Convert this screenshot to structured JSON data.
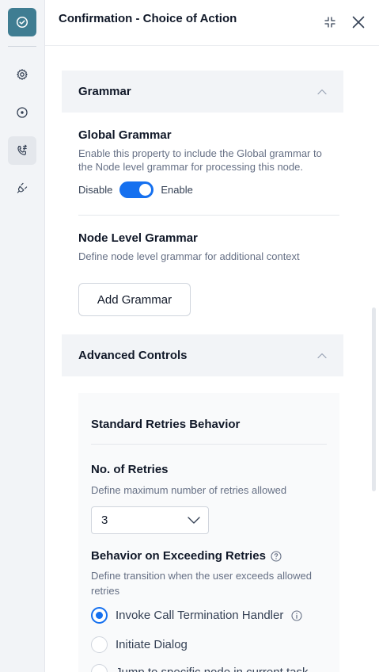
{
  "header": {
    "title": "Confirmation - Choice of Action"
  },
  "rail": {
    "items": [
      "check-circle-icon",
      "gear-icon",
      "target-icon",
      "phone-transfer-icon",
      "plug-icon"
    ],
    "active": "phone-transfer-icon"
  },
  "grammar": {
    "section_title": "Grammar",
    "global_title": "Global Grammar",
    "global_desc_line1": "Enable this property to include the Global grammar to",
    "global_desc_line2": "the Node level grammar for processing this node.",
    "toggle_off_label": "Disable",
    "toggle_on_label": "Enable",
    "toggle_enabled": true,
    "node_title": "Node Level Grammar",
    "node_desc": "Define node level grammar for additional context",
    "add_button": "Add Grammar"
  },
  "advanced": {
    "section_title": "Advanced Controls",
    "panel_title": "Standard Retries Behavior",
    "retries_label": "No. of Retries",
    "retries_desc": "Define maximum number of retries allowed",
    "retries_value": "3",
    "behavior_label": "Behavior on Exceeding Retries",
    "behavior_desc_line1": "Define transition when the user exceeds allowed",
    "behavior_desc_line2": "retries",
    "options": [
      {
        "label": "Invoke Call Termination Handler",
        "selected": true
      },
      {
        "label": "Initiate Dialog",
        "selected": false
      },
      {
        "label": "Jump to specific node in current task",
        "selected": false
      }
    ]
  },
  "colors": {
    "accent": "#1570ef",
    "brand": "#3f7d92"
  }
}
